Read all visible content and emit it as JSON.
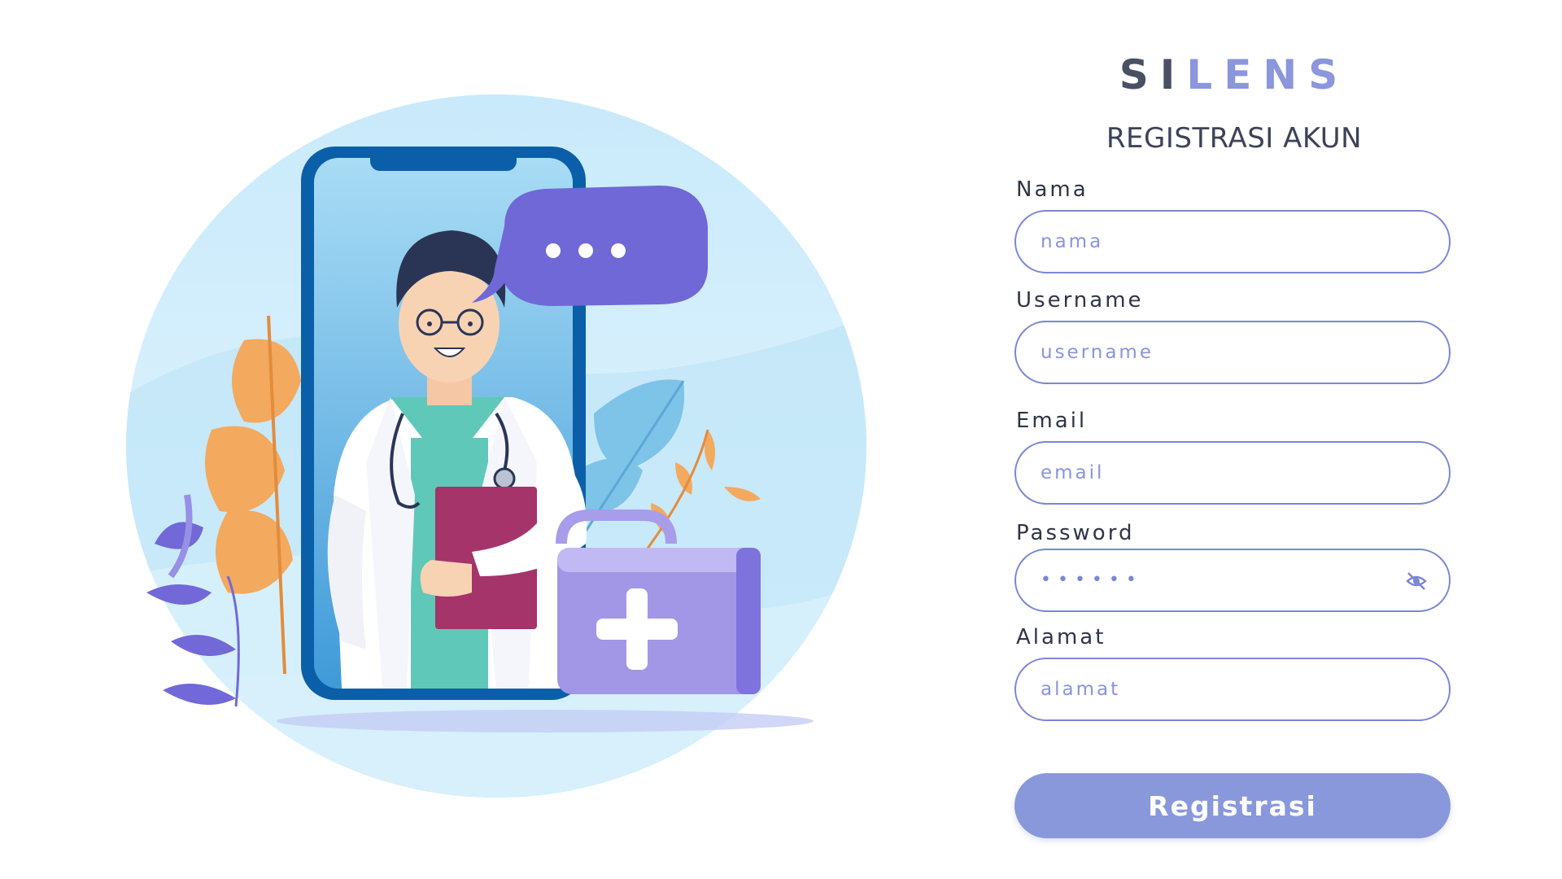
{
  "brand": {
    "part1": "SI",
    "part2": "LENS",
    "color_dark": "#4a5063",
    "color_accent": "#8c96dc"
  },
  "form": {
    "title": "REGISTRASI AKUN",
    "fields": [
      {
        "label": "Nama",
        "placeholder": "nama",
        "type": "text"
      },
      {
        "label": "Username",
        "placeholder": "username",
        "type": "text"
      },
      {
        "label": "Email",
        "placeholder": "email",
        "type": "email"
      },
      {
        "label": "Password",
        "masked_value": "••••••",
        "type": "password",
        "toggle_icon": "eye-slash-icon"
      },
      {
        "label": "Alamat",
        "placeholder": "alamat",
        "type": "text"
      }
    ],
    "submit_label": "Registrasi"
  },
  "illustration": {
    "subject": "doctor-in-phone",
    "speech_bubble_icon": "ellipsis-icon",
    "medical_kit_icon": "plus-icon"
  },
  "colors": {
    "accent": "#7b86d6",
    "button": "#8898db",
    "text": "#3d4357"
  }
}
